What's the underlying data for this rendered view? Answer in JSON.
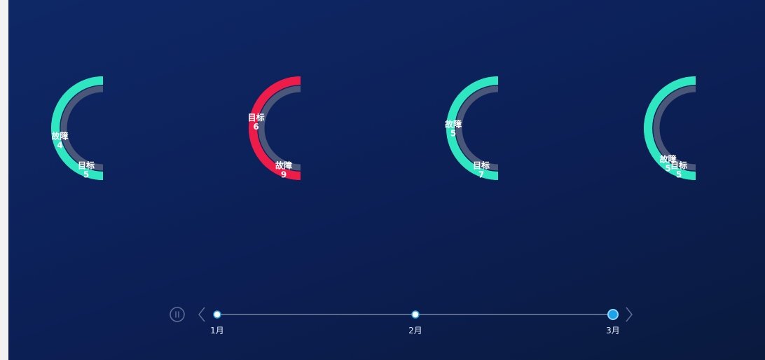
{
  "chart_data": {
    "type": "pie",
    "timeline": {
      "labels": [
        "1月",
        "2月",
        "3月"
      ],
      "current_index": 2,
      "playing": false
    },
    "colors": {
      "normal": "#2ee6c0",
      "alert": "#ee1c49",
      "track": "#4a5779"
    },
    "series": [
      {
        "items": [
          {
            "name": "故障",
            "value": 4
          },
          {
            "name": "目标",
            "value": 5
          }
        ],
        "status": "normal"
      },
      {
        "items": [
          {
            "name": "目标",
            "value": 6
          },
          {
            "name": "故障",
            "value": 9
          }
        ],
        "status": "alert"
      },
      {
        "items": [
          {
            "name": "故障",
            "value": 5
          },
          {
            "name": "目标",
            "value": 7
          }
        ],
        "status": "normal"
      },
      {
        "items": [
          {
            "name": "故障",
            "value": 5
          },
          {
            "name": "目标",
            "value": 5
          }
        ],
        "status": "normal"
      }
    ]
  }
}
